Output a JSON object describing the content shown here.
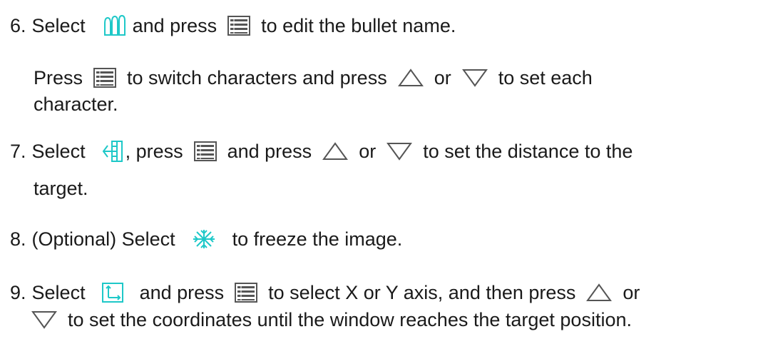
{
  "colors": {
    "text": "#1a1a1a",
    "accent": "#1ec8c8",
    "icon_gray": "#555555"
  },
  "icons": {
    "bullet": "bullet-icon",
    "menu": "menu-icon",
    "up": "up-triangle-icon",
    "down": "down-triangle-icon",
    "distance": "distance-icon",
    "freeze": "freeze-icon",
    "axis": "axis-icon"
  },
  "steps": {
    "s6": {
      "num": "6.",
      "a": "Select",
      "b": "and press",
      "c": "to edit the bullet name.",
      "p2a": "Press",
      "p2b": "to switch characters and press",
      "p2c": "or",
      "p2d": "to set each",
      "p2e": "character."
    },
    "s7": {
      "num": "7.",
      "a": "Select",
      "b": ", press",
      "c": "and press",
      "d": "or",
      "e": "to set the distance to the",
      "f": "target."
    },
    "s8": {
      "num": "8.",
      "a": "(Optional) Select",
      "b": "to freeze the image."
    },
    "s9": {
      "num": "9.",
      "a": "Select",
      "b": "and press",
      "c": "to select X or Y axis, and then press",
      "d": "or",
      "e": "to set the coordinates until the window reaches the target position."
    }
  }
}
